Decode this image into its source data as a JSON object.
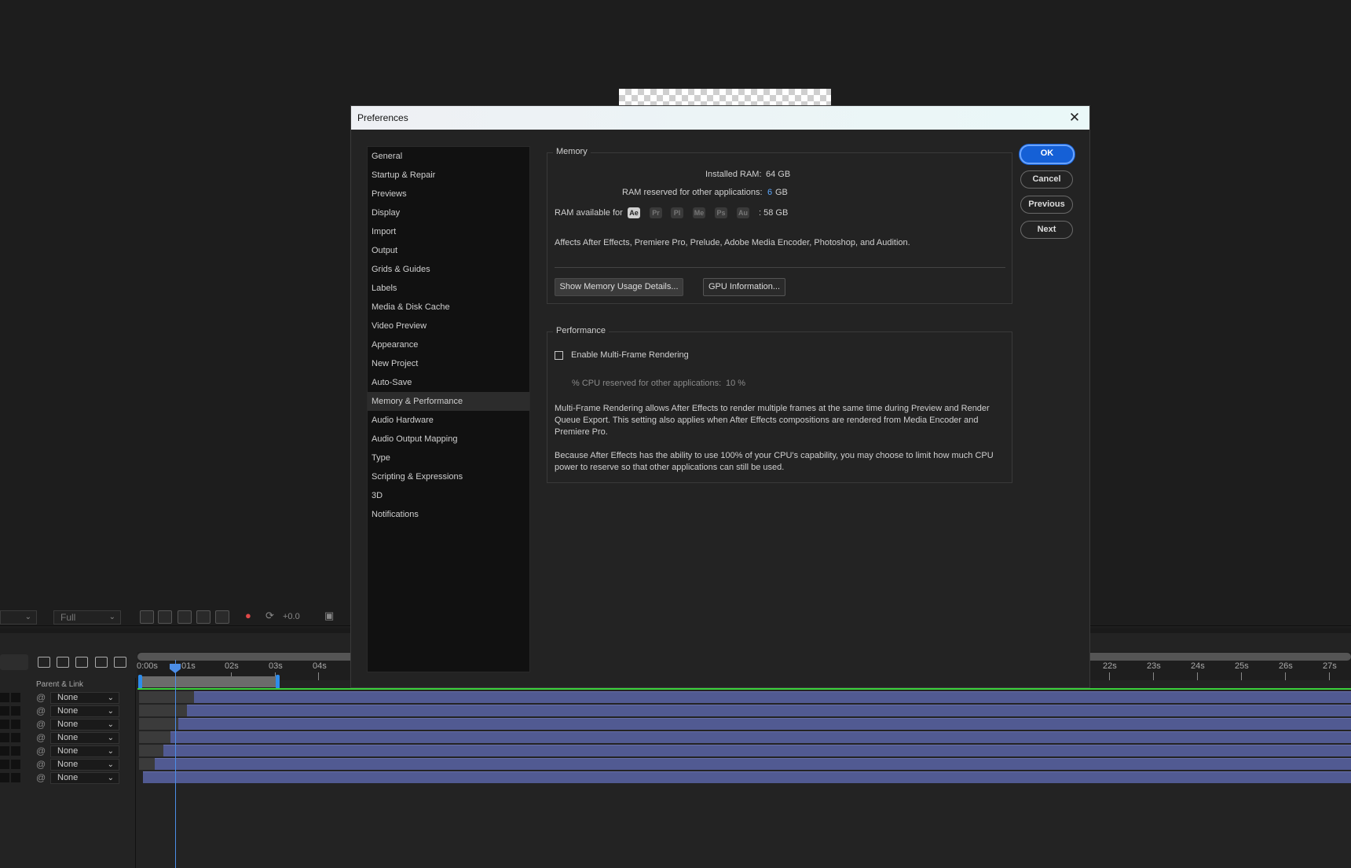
{
  "dialog": {
    "title": "Preferences",
    "close_icon": "close-icon",
    "nav": [
      "General",
      "Startup & Repair",
      "Previews",
      "Display",
      "Import",
      "Output",
      "Grids & Guides",
      "Labels",
      "Media & Disk Cache",
      "Video Preview",
      "Appearance",
      "New Project",
      "Auto-Save",
      "Memory & Performance",
      "Audio Hardware",
      "Audio Output Mapping",
      "Type",
      "Scripting & Expressions",
      "3D",
      "Notifications"
    ],
    "active_nav": "Memory & Performance",
    "buttons": {
      "ok": "OK",
      "cancel": "Cancel",
      "previous": "Previous",
      "next": "Next"
    }
  },
  "memory": {
    "title": "Memory",
    "installed_label": "Installed RAM:",
    "installed_value": "64 GB",
    "reserved_label": "RAM reserved for other applications:",
    "reserved_value": "6",
    "reserved_unit": "GB",
    "available_label": "RAM available for",
    "apps": [
      "Ae",
      "Pr",
      "Pl",
      "Me",
      "Ps",
      "Au"
    ],
    "available_value": ": 58 GB",
    "affects_text": "Affects After Effects, Premiere Pro, Prelude, Adobe Media Encoder, Photoshop, and Audition.",
    "show_usage_button": "Show Memory Usage Details...",
    "gpu_button": "GPU Information..."
  },
  "performance": {
    "title": "Performance",
    "mfr_label": "Enable Multi-Frame Rendering",
    "mfr_checked": false,
    "cpu_label": "% CPU reserved for other applications:",
    "cpu_value": "10 %",
    "para1_line1": "Multi-Frame Rendering allows After Effects to render multiple frames at the same time during Preview and Render",
    "para1_line2": "Queue Export. This setting also applies when After Effects compositions are rendered from Media Encoder and",
    "para1_line3": "Premiere Pro.",
    "para2_line1": "Because After Effects has the ability to use 100% of your CPU's capability, you may choose to limit how much CPU",
    "para2_line2": "power to reserve so that other applications can still be used."
  },
  "viewer_bar": {
    "resolution": "Full",
    "exposure": "+0.0"
  },
  "timeline": {
    "parent_label": "Parent & Link",
    "ticks_left": [
      "0:00s",
      "01s",
      "02s",
      "03s",
      "04s"
    ],
    "ticks_right": [
      "22s",
      "23s",
      "24s",
      "25s",
      "26s",
      "27s"
    ],
    "layer_parent_values": [
      "None",
      "None",
      "None",
      "None",
      "None",
      "None",
      "None"
    ]
  }
}
